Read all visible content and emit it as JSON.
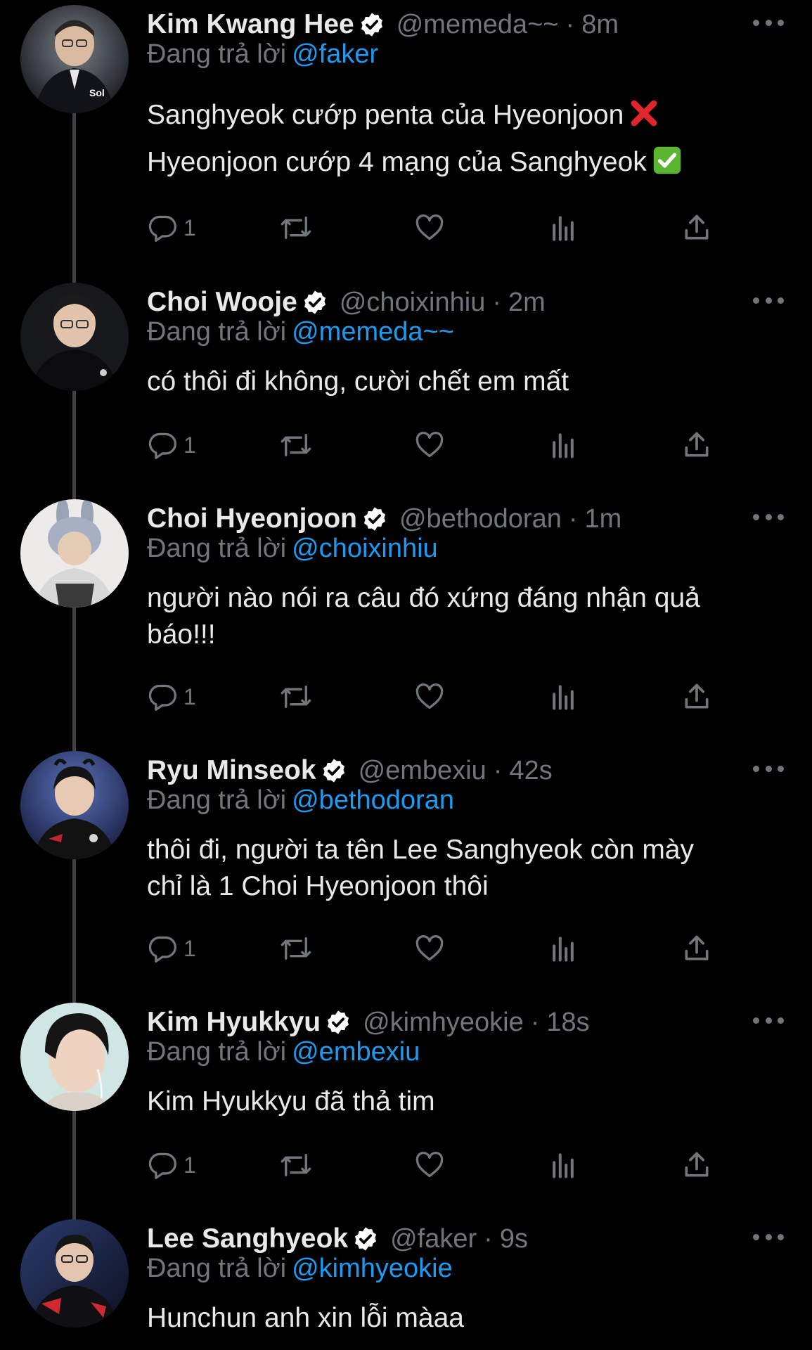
{
  "colors": {
    "background": "#000000",
    "text_primary": "#e7e9ea",
    "text_secondary": "#71767b",
    "mention": "#1d9bf0",
    "verified_badge": "#ffffff"
  },
  "replying_label": "Đang trả lời",
  "tweets": [
    {
      "name": "Kim Kwang Hee",
      "handle": "@memeda~~",
      "time": "8m",
      "replying_to": "@faker",
      "lines": [
        "Sanghyeok cướp penta của Hyeonjoon",
        "Hyeonjoon cướp 4 mạng của Sanghyeok"
      ],
      "line_emojis": [
        "cross-mark-emoji",
        "check-mark-button-emoji"
      ],
      "reply_count": "1"
    },
    {
      "name": "Choi Wooje",
      "handle": "@choixinhiu",
      "time": "2m",
      "replying_to": "@memeda~~",
      "lines": [
        "có thôi đi không, cười chết em mất"
      ],
      "reply_count": "1"
    },
    {
      "name": "Choi Hyeonjoon",
      "handle": "@bethodoran",
      "time": "1m",
      "replying_to": "@choixinhiu",
      "lines": [
        "người nào nói ra câu đó xứng đáng nhận quả",
        "báo!!!"
      ],
      "reply_count": "1"
    },
    {
      "name": "Ryu Minseok",
      "handle": "@embexiu",
      "time": "42s",
      "replying_to": "@bethodoran",
      "lines": [
        "thôi đi, người ta tên Lee Sanghyeok còn mày",
        "chỉ là 1 Choi Hyeonjoon thôi"
      ],
      "reply_count": "1"
    },
    {
      "name": "Kim Hyukkyu",
      "handle": "@kimhyeokie",
      "time": "18s",
      "replying_to": "@embexiu",
      "lines": [
        "Kim Hyukkyu đã thả tim"
      ],
      "reply_count": "1"
    },
    {
      "name": "Lee Sanghyeok",
      "handle": "@faker",
      "time": "9s",
      "replying_to": "@kimhyeokie",
      "lines": [
        "Hunchun anh xin lỗi màaa"
      ]
    }
  ],
  "icons": {
    "reply": "reply-icon",
    "retweet": "retweet-icon",
    "like": "heart-icon",
    "views": "views-icon",
    "share": "share-icon",
    "more": "more-icon",
    "verified": "verified-badge-icon"
  }
}
